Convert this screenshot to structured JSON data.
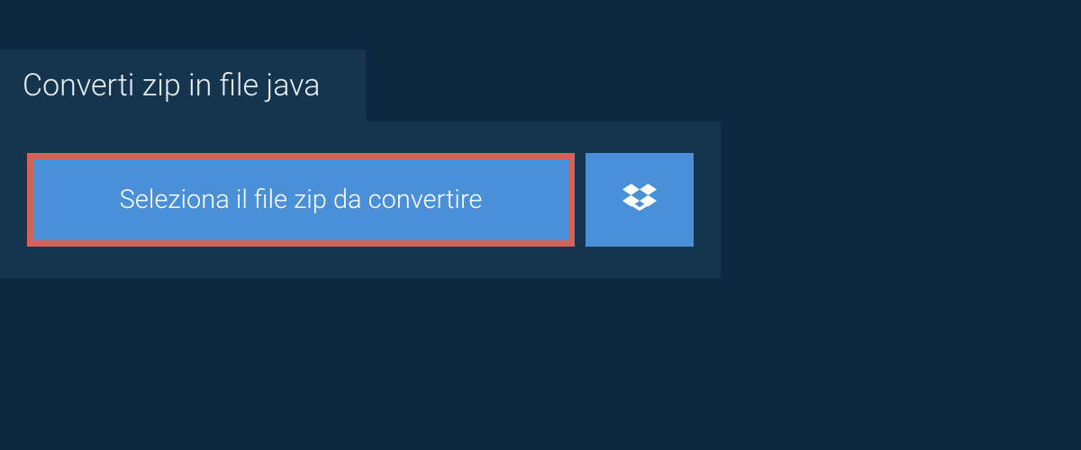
{
  "header": {
    "tab_label": "Converti zip in file java"
  },
  "actions": {
    "select_file_label": "Seleziona il file zip da convertire"
  },
  "colors": {
    "background": "#0d2942",
    "panel": "#15354f",
    "button": "#4a90d9",
    "highlight_border": "#d36258"
  }
}
